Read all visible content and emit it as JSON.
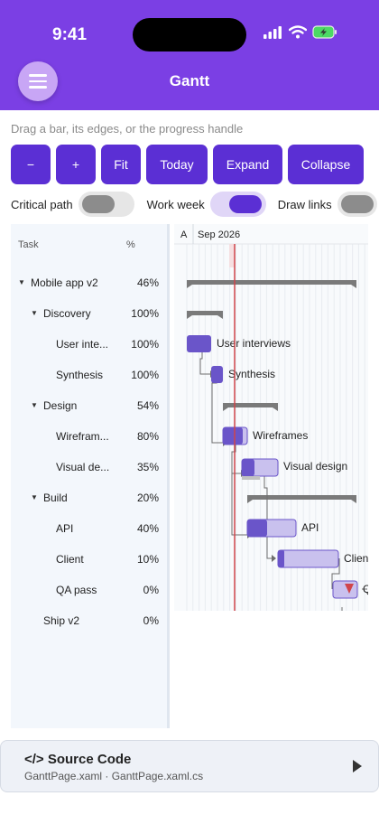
{
  "status": {
    "time": "9:41"
  },
  "header": {
    "title": "Gantt"
  },
  "hint": "Drag a bar, its edges, or the progress handle",
  "toolbar": {
    "buttons": [
      {
        "key": "zoom-out",
        "label": "−"
      },
      {
        "key": "zoom-in",
        "label": "+"
      },
      {
        "key": "fit",
        "label": "Fit"
      },
      {
        "key": "today",
        "label": "Today"
      },
      {
        "key": "expand",
        "label": "Expand"
      },
      {
        "key": "collapse",
        "label": "Collapse"
      }
    ]
  },
  "toggles": {
    "critical_path": {
      "label": "Critical path",
      "on": false
    },
    "work_week": {
      "label": "Work week",
      "on": true
    },
    "draw_links": {
      "label": "Draw links",
      "on": false
    }
  },
  "gantt": {
    "col_task": "Task",
    "col_pct": "%",
    "timeline_label_a": "A",
    "timeline_label_month": "Sep 2026",
    "tasks": [
      {
        "name": "Mobile app v2",
        "pct": "46%",
        "level": 0,
        "expander": "▼"
      },
      {
        "name": "Discovery",
        "pct": "100%",
        "level": 1,
        "expander": "▼"
      },
      {
        "name": "User inte...",
        "pct": "100%",
        "level": 2,
        "expander": ""
      },
      {
        "name": "Synthesis",
        "pct": "100%",
        "level": 2,
        "expander": ""
      },
      {
        "name": "Design",
        "pct": "54%",
        "level": 1,
        "expander": "▼"
      },
      {
        "name": "Wirefram...",
        "pct": "80%",
        "level": 2,
        "expander": ""
      },
      {
        "name": "Visual de...",
        "pct": "35%",
        "level": 2,
        "expander": ""
      },
      {
        "name": "Build",
        "pct": "20%",
        "level": 1,
        "expander": "▼"
      },
      {
        "name": "API",
        "pct": "40%",
        "level": 2,
        "expander": ""
      },
      {
        "name": "Client",
        "pct": "10%",
        "level": 2,
        "expander": ""
      },
      {
        "name": "QA pass",
        "pct": "0%",
        "level": 2,
        "expander": ""
      },
      {
        "name": "Ship v2",
        "pct": "0%",
        "level": 1,
        "expander": ""
      }
    ],
    "bar_labels": [
      "User interviews",
      "Synthesis",
      "Wireframes",
      "Visual design",
      "API",
      "Clien",
      "Q"
    ]
  },
  "source": {
    "title": "</> Source Code",
    "files": "GanttPage.xaml  ·  GanttPage.xaml.cs"
  },
  "colors": {
    "header": "#7b3fe4",
    "button": "#5b2fd4",
    "bar": "#6a55c9",
    "bar_light": "#c9c1ee",
    "summary": "#7a7a7a",
    "today_line": "#d0454b"
  }
}
